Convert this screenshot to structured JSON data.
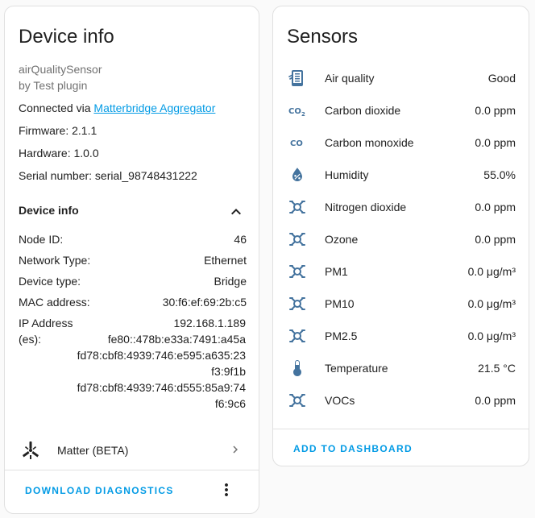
{
  "device": {
    "title": "Device info",
    "model": "airQualitySensor",
    "manufacturer": "by Test plugin",
    "connected_via_prefix": "Connected via ",
    "connected_via_link": "Matterbridge Aggregator",
    "firmware": "Firmware: 2.1.1",
    "hardware": "Hardware: 1.0.0",
    "serial": "Serial number: serial_98748431222",
    "section_title": "Device info",
    "node_id_label": "Node ID:",
    "node_id_value": "46",
    "network_type_label": "Network Type:",
    "network_type_value": "Ethernet",
    "device_type_label": "Device type:",
    "device_type_value": "Bridge",
    "mac_label": "MAC address:",
    "mac_value": "30:f6:ef:69:2b:c5",
    "ip_label": "IP Address (es):",
    "ip_values": [
      "192.168.1.189",
      "fe80::478b:e33a:7491:a45a",
      "fd78:cbf8:4939:746:e595:a635:23f3:9f1b",
      "fd78:cbf8:4939:746:d555:85a9:74f6:9c6"
    ],
    "matter_label": "Matter (BETA)",
    "download_label": "DOWNLOAD DIAGNOSTICS"
  },
  "sensors": {
    "title": "Sensors",
    "items": [
      {
        "icon": "air-filter-icon",
        "name": "Air quality",
        "value": "Good"
      },
      {
        "icon": "co2-icon",
        "name": "Carbon dioxide",
        "value": "0.0 ppm"
      },
      {
        "icon": "co-icon",
        "name": "Carbon monoxide",
        "value": "0.0 ppm"
      },
      {
        "icon": "water-percent-icon",
        "name": "Humidity",
        "value": "55.0%"
      },
      {
        "icon": "molecule-icon",
        "name": "Nitrogen dioxide",
        "value": "0.0 ppm"
      },
      {
        "icon": "molecule-icon",
        "name": "Ozone",
        "value": "0.0 ppm"
      },
      {
        "icon": "molecule-icon",
        "name": "PM1",
        "value": "0.0 μg/m³"
      },
      {
        "icon": "molecule-icon",
        "name": "PM10",
        "value": "0.0 μg/m³"
      },
      {
        "icon": "molecule-icon",
        "name": "PM2.5",
        "value": "0.0 μg/m³"
      },
      {
        "icon": "thermometer-icon",
        "name": "Temperature",
        "value": "21.5 °C"
      },
      {
        "icon": "molecule-icon",
        "name": "VOCs",
        "value": "0.0 ppm"
      }
    ],
    "add_label": "ADD TO DASHBOARD"
  },
  "colors": {
    "accent": "#039be5",
    "icon": "#44739e",
    "text": "#212121",
    "muted": "#727272",
    "divider": "#e0e0e0"
  }
}
